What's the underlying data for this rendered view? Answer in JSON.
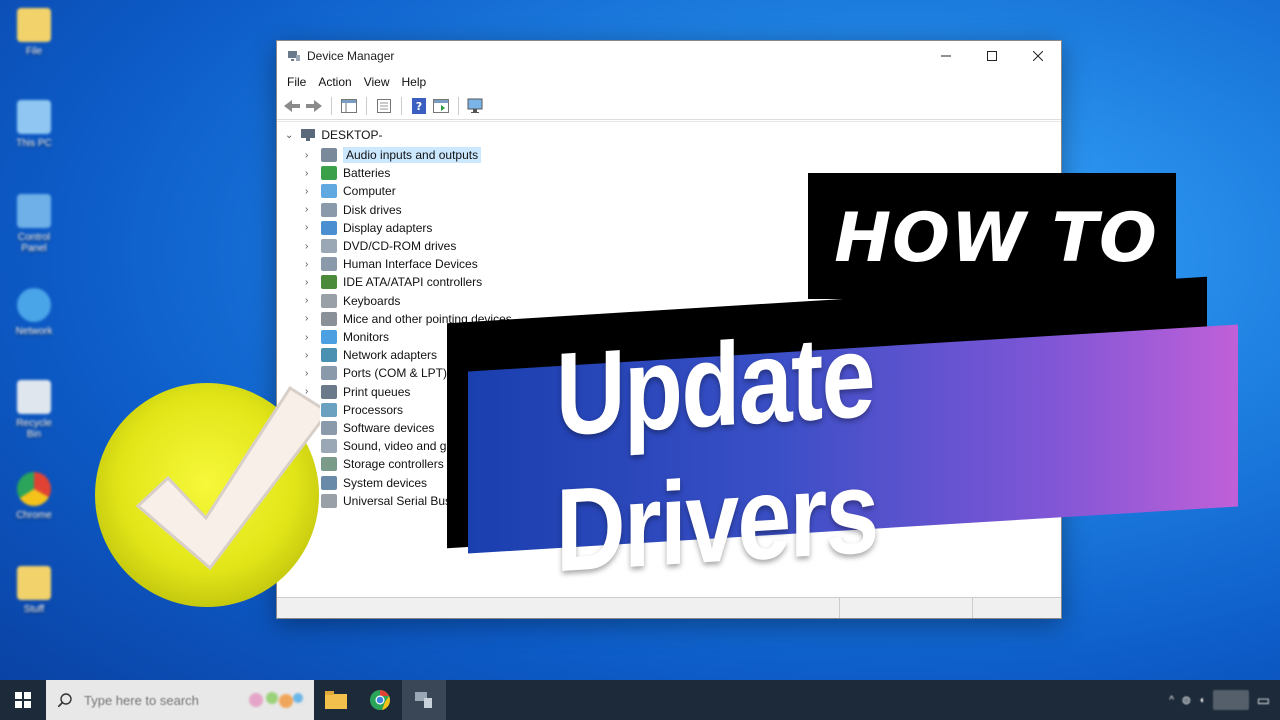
{
  "desktop": {
    "icons": [
      {
        "label": "File"
      },
      {
        "label": "This PC"
      },
      {
        "label": "Control Panel"
      },
      {
        "label": "Network"
      },
      {
        "label": "Recycle Bin"
      },
      {
        "label": "Chrome"
      },
      {
        "label": "Stuff"
      }
    ]
  },
  "window": {
    "title": "Device Manager",
    "menu": [
      "File",
      "Action",
      "View",
      "Help"
    ],
    "root": "DESKTOP-",
    "devices": [
      "Audio inputs and outputs",
      "Batteries",
      "Computer",
      "Disk drives",
      "Display adapters",
      "DVD/CD-ROM drives",
      "Human Interface Devices",
      "IDE ATA/ATAPI controllers",
      "Keyboards",
      "Mice and other pointing devices",
      "Monitors",
      "Network adapters",
      "Ports (COM & LPT)",
      "Print queues",
      "Processors",
      "Software devices",
      "Sound, video and game controllers",
      "Storage controllers",
      "System devices",
      "Universal Serial Bus controllers"
    ],
    "selected_device": "Audio inputs and outputs"
  },
  "overlay": {
    "howto": "HOW TO",
    "headline": "Update Drivers"
  },
  "taskbar": {
    "search_placeholder": "Type here to search"
  },
  "colors": {
    "accent_gradient_start": "#1a3fae",
    "accent_gradient_end": "#c060d8",
    "badge_yellow": "#e6ea1a",
    "selection": "#cce8ff"
  }
}
